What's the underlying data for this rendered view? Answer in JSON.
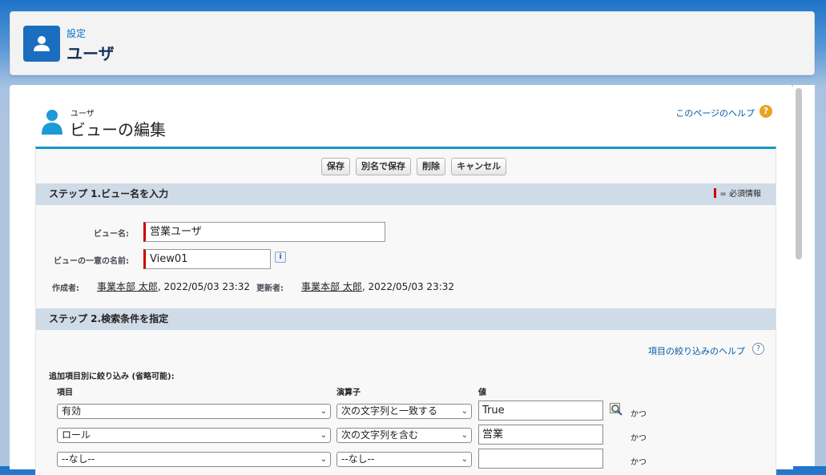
{
  "header": {
    "breadcrumb": "設定",
    "title": "ユーザ"
  },
  "view": {
    "object_label": "ユーザ",
    "page_title": "ビューの編集",
    "help_link": "このページのヘルプ",
    "help_icon": "?"
  },
  "buttons": {
    "save": "保存",
    "save_as": "別名で保存",
    "delete": "削除",
    "cancel": "キャンセル"
  },
  "step1": {
    "title": "ステップ 1.ビュー名を入力",
    "required_legend": "= 必須情報",
    "view_name_label": "ビュー名:",
    "view_name_value": "営業ユーザ",
    "unique_name_label": "ビューの一意の名前:",
    "unique_name_value": "View01",
    "info_icon": "i",
    "created_by_label": "作成者:",
    "created_by_user": "事業本部 太郎",
    "created_by_date": ", 2022/05/03 23:32",
    "modified_by_label": "更新者:",
    "modified_by_user": "事業本部 太郎",
    "modified_by_date": ", 2022/05/03 23:32"
  },
  "step2": {
    "title": "ステップ 2.検索条件を指定",
    "filter_help_link": "項目の絞り込みのヘルプ",
    "filter_help_icon": "?",
    "filter_heading": "追加項目別に絞り込み (省略可能):",
    "col_field": "項目",
    "col_operator": "演算子",
    "col_value": "値",
    "filters": [
      {
        "field": "有効",
        "operator": "次の文字列と一致する",
        "value": "True",
        "conjunction": "かつ"
      },
      {
        "field": "ロール",
        "operator": "次の文字列を含む",
        "value": "営業",
        "conjunction": "かつ"
      },
      {
        "field": "--なし--",
        "operator": "--なし--",
        "value": "",
        "conjunction": "かつ"
      }
    ]
  },
  "colors": {
    "accent": "#1797c0",
    "section_bar": "#cfdbe6",
    "required": "#cc0000",
    "link": "#015ba7"
  }
}
